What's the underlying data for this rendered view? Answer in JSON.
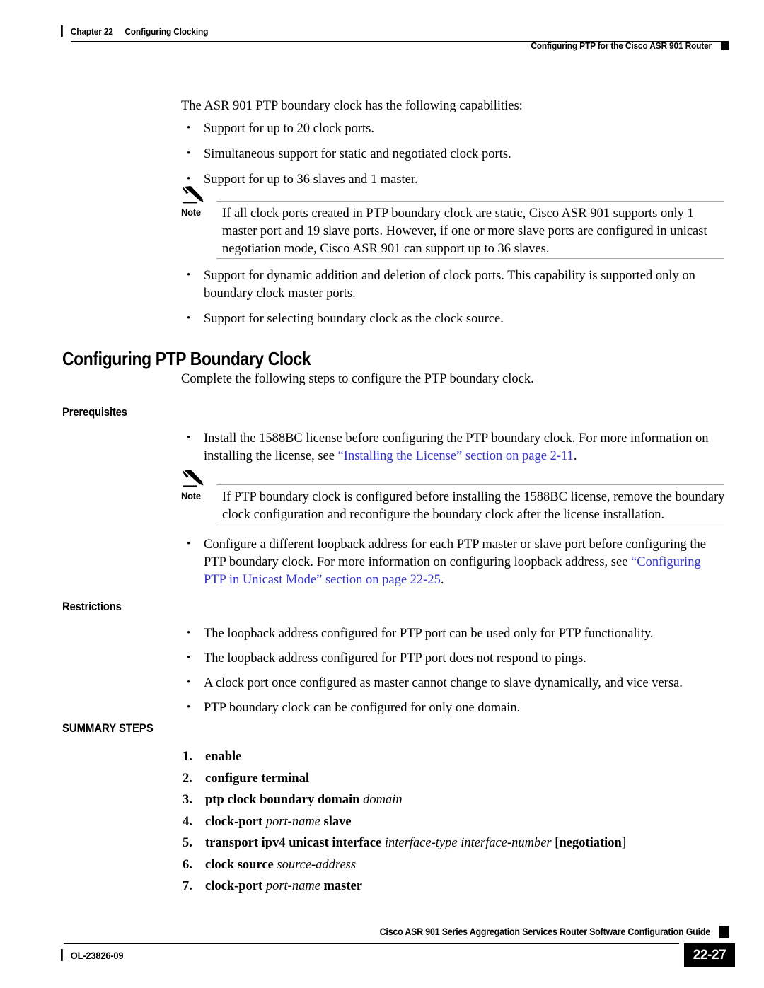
{
  "header": {
    "chapter": "Chapter 22",
    "chapter_title": "Configuring Clocking",
    "running_head": "Configuring PTP for the Cisco ASR 901 Router"
  },
  "intro": {
    "lead": "The ASR 901 PTP boundary clock has the following capabilities:",
    "bullets": [
      "Support for up to 20 clock ports.",
      "Simultaneous support for static and negotiated clock ports.",
      "Support for up to 36 slaves and 1 master."
    ]
  },
  "note1": {
    "label": "Note",
    "icon": "pencil-note-icon",
    "text": "If all clock ports created in PTP boundary clock are static, Cisco ASR 901 supports only 1 master port and 19 slave ports. However, if one or more slave ports are configured in unicast negotiation mode, Cisco ASR 901 can support up to 36 slaves."
  },
  "capabilities2": {
    "bullets": [
      "Support for dynamic addition and deletion of clock ports. This capability is supported only on boundary clock master ports.",
      "Support for selecting boundary clock as the clock source."
    ]
  },
  "section": {
    "title": "Configuring PTP Boundary Clock",
    "intro": "Complete the following steps to configure the PTP boundary clock."
  },
  "prerequisites": {
    "heading": "Prerequisites",
    "bullet1_pre": "Install the 1588BC license before configuring the PTP boundary clock. For more information on installing the license, see ",
    "bullet1_link": "“Installing the License” section on page 2-11",
    "bullet1_post": "."
  },
  "note2": {
    "label": "Note",
    "icon": "pencil-note-icon",
    "text": "If PTP boundary clock is configured before installing the 1588BC license, remove the boundary clock configuration and reconfigure the boundary clock after the license installation."
  },
  "prerequisites_cont": {
    "bullet2_pre": "Configure a different loopback address for each PTP master or slave port before configuring the PTP boundary clock. For more information on configuring loopback address, see ",
    "bullet2_link": "“Configuring PTP in Unicast Mode” section on page 22-25",
    "bullet2_post": "."
  },
  "restrictions": {
    "heading": "Restrictions",
    "bullets": [
      "The loopback address configured for PTP port can be used only for PTP functionality.",
      "The loopback address configured for PTP port does not respond to pings.",
      "A clock port once configured as master cannot change to slave dynamically, and vice versa.",
      "PTP boundary clock can be configured for only one domain."
    ]
  },
  "summary_steps": {
    "heading": "SUMMARY STEPS",
    "steps": [
      {
        "num": "1.",
        "parts": [
          {
            "t": "enable",
            "s": "b"
          }
        ]
      },
      {
        "num": "2.",
        "parts": [
          {
            "t": "configure terminal",
            "s": "b"
          }
        ]
      },
      {
        "num": "3.",
        "parts": [
          {
            "t": "ptp clock boundary domain ",
            "s": "b"
          },
          {
            "t": "domain",
            "s": "i"
          }
        ]
      },
      {
        "num": "4.",
        "parts": [
          {
            "t": "clock-port ",
            "s": "b"
          },
          {
            "t": "port-name",
            "s": "i"
          },
          {
            "t": " slave",
            "s": "b"
          }
        ]
      },
      {
        "num": "5.",
        "parts": [
          {
            "t": "transport ipv4 unicast interface ",
            "s": "b"
          },
          {
            "t": "interface-type interface-number",
            "s": "i"
          },
          {
            "t": " [",
            "s": "n"
          },
          {
            "t": "negotiation",
            "s": "b"
          },
          {
            "t": "]",
            "s": "n"
          }
        ]
      },
      {
        "num": "6.",
        "parts": [
          {
            "t": "clock source ",
            "s": "b"
          },
          {
            "t": "source-address",
            "s": "i"
          }
        ]
      },
      {
        "num": "7.",
        "parts": [
          {
            "t": "clock-port ",
            "s": "b"
          },
          {
            "t": "port-name",
            "s": "i"
          },
          {
            "t": " master",
            "s": "b"
          }
        ]
      }
    ]
  },
  "footer": {
    "book_title": "Cisco ASR 901 Series Aggregation Services Router Software Configuration Guide",
    "doc_id": "OL-23826-09",
    "page_number": "22-27"
  },
  "colors": {
    "link": "#3333cc",
    "rule": "#a6a6a6",
    "text": "#000000"
  }
}
